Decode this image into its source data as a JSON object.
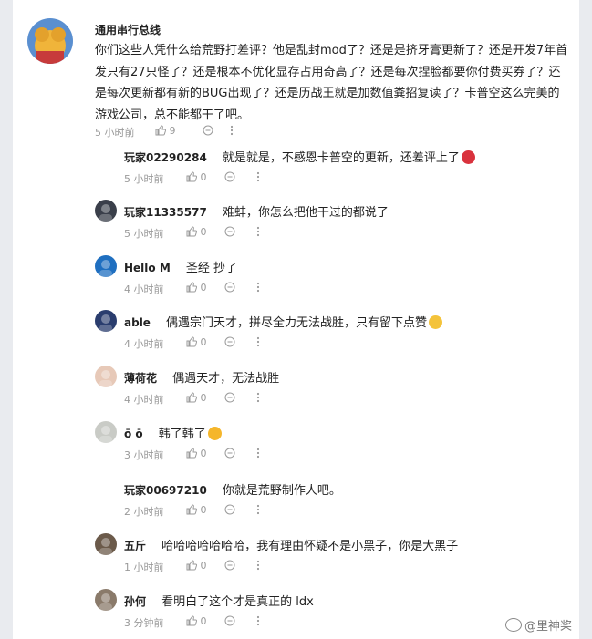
{
  "main_comment": {
    "user": "通用串行总线",
    "text": "你们这些人凭什么给荒野打差评？他是乱封mod了？还是是挤牙膏更新了？还是开发7年首发只有27只怪了？还是根本不优化显存占用奇高了？还是每次捏脸都要你付费买券了？还是每次更新都有新的BUG出现了？还是历战王就是加数值粪招复读了？卡普空这么完美的游戏公司，总不能都干了吧。",
    "time": "5 小时前",
    "likes": "9"
  },
  "replies": [
    {
      "user": "玩家02290284",
      "text": "就是就是，不感恩卡普空的更新，还差评上了",
      "time": "5 小时前",
      "likes": "0",
      "has_avatar": false,
      "emoji": "angry-face"
    },
    {
      "user": "玩家11335577",
      "text": "难蚌，你怎么把他干过的都说了",
      "time": "5 小时前",
      "likes": "0",
      "has_avatar": true,
      "avatar_color": "#3a3f4a"
    },
    {
      "user": "Hello M",
      "text": "圣经 抄了",
      "time": "4 小时前",
      "likes": "0",
      "has_avatar": true,
      "avatar_color": "#1f6fc0"
    },
    {
      "user": "able",
      "text": "偶遇宗门天才，拼尽全力无法战胜，只有留下点赞",
      "time": "4 小时前",
      "likes": "0",
      "has_avatar": true,
      "avatar_color": "#2a3d6e",
      "emoji": "smirk-face"
    },
    {
      "user": "薄荷花",
      "text": "偶遇天才，无法战胜",
      "time": "4 小时前",
      "likes": "0",
      "has_avatar": true,
      "avatar_color": "#e7c9b8"
    },
    {
      "user": "ō ō",
      "text": "韩了韩了",
      "time": "3 小时前",
      "likes": "0",
      "has_avatar": true,
      "avatar_color": "#c9cbc6",
      "emoji": "tongue-face"
    },
    {
      "user": "玩家00697210",
      "text": "你就是荒野制作人吧。",
      "time": "2 小时前",
      "likes": "0",
      "has_avatar": false
    },
    {
      "user": "五斤",
      "text": "哈哈哈哈哈哈哈，我有理由怀疑不是小黑子，你是大黑子",
      "time": "1 小时前",
      "likes": "0",
      "has_avatar": true,
      "avatar_color": "#6b5a4a"
    },
    {
      "user": "孙何",
      "text": "看明白了这个才是真正的 ldx",
      "time": "3 分钟前",
      "likes": "0",
      "has_avatar": true,
      "avatar_color": "#8a7a6a"
    }
  ],
  "watermark": "@里神桨",
  "colors": {
    "meta": "#9a9a9a",
    "text": "#222222",
    "background": "#e9ebef"
  }
}
